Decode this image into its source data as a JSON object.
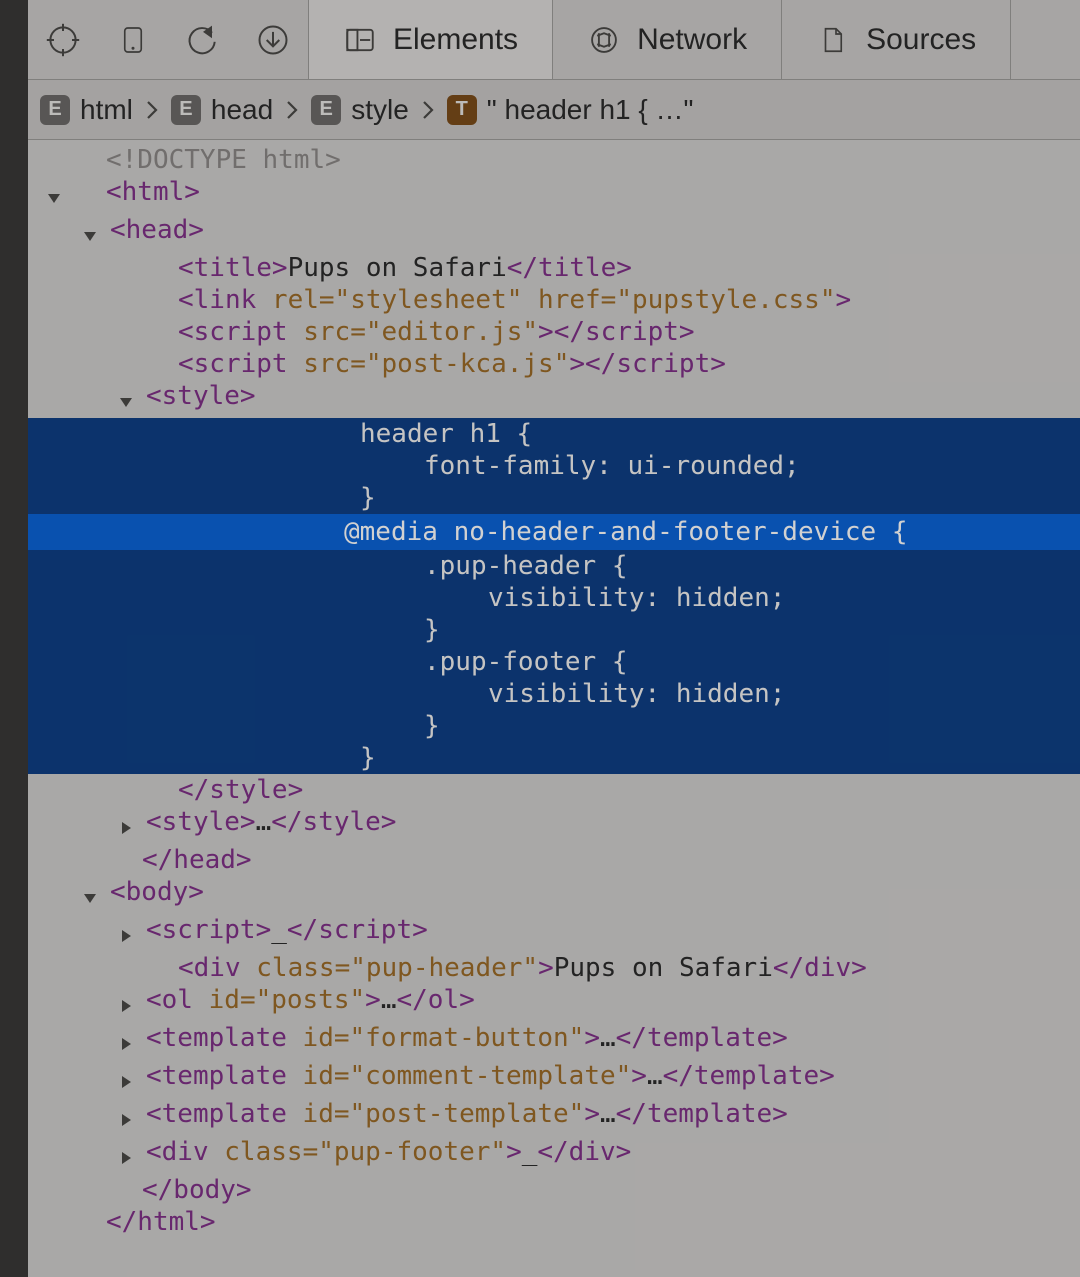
{
  "tabs": {
    "elements": "Elements",
    "network": "Network",
    "sources": "Sources"
  },
  "breadcrumb": {
    "item0_badge": "E",
    "item0": "html",
    "item1_badge": "E",
    "item1": "head",
    "item2_badge": "E",
    "item2": "style",
    "item3_badge": "T",
    "item3": "\" header h1 { …\""
  },
  "tree": {
    "doctype": "<!DOCTYPE html>",
    "html_open": "<html>",
    "head_open": "<head>",
    "title_open": "<title>",
    "title_text": "Pups on Safari",
    "title_close": "</title>",
    "link": "<link rel=\"stylesheet\" href=\"pupstyle.css\">",
    "link_rel_k": "rel",
    "link_rel_v": "\"stylesheet\"",
    "link_href_k": "href",
    "link_href_v": "\"pupstyle.css\"",
    "script1_src_k": "src",
    "script1_src_v": "\"editor.js\"",
    "script2_src_k": "src",
    "script2_src_v": "\"post-kca.js\"",
    "style_open": "<style>",
    "css_l1": "header h1 {",
    "css_l2": "font-family: ui-rounded;",
    "css_l3": "}",
    "css_l4": "@media no-header-and-footer-device {",
    "css_l5": ".pup-header {",
    "css_l6": "visibility: hidden;",
    "css_l7": "}",
    "css_l8": ".pup-footer {",
    "css_l9": "visibility: hidden;",
    "css_l10": "}",
    "css_l11": "}",
    "style_close": "</style>",
    "style2": "<style>…</style>",
    "head_close": "</head>",
    "body_open": "<body>",
    "body_script": "<script>…</script",
    "pupheader_open_a": "class",
    "pupheader_open_v": "\"pup-header\"",
    "pupheader_text": "Pups on Safari",
    "ol_id_k": "id",
    "ol_id_v": "\"posts\"",
    "tmpl1_k": "id",
    "tmpl1_v": "\"format-button\"",
    "tmpl2_k": "id",
    "tmpl2_v": "\"comment-template\"",
    "tmpl3_k": "id",
    "tmpl3_v": "\"post-template\"",
    "pupfooter_k": "class",
    "pupfooter_v": "\"pup-footer\"",
    "body_close": "</body>",
    "html_close": "</html>",
    "ell": "…",
    "uell": "_"
  }
}
